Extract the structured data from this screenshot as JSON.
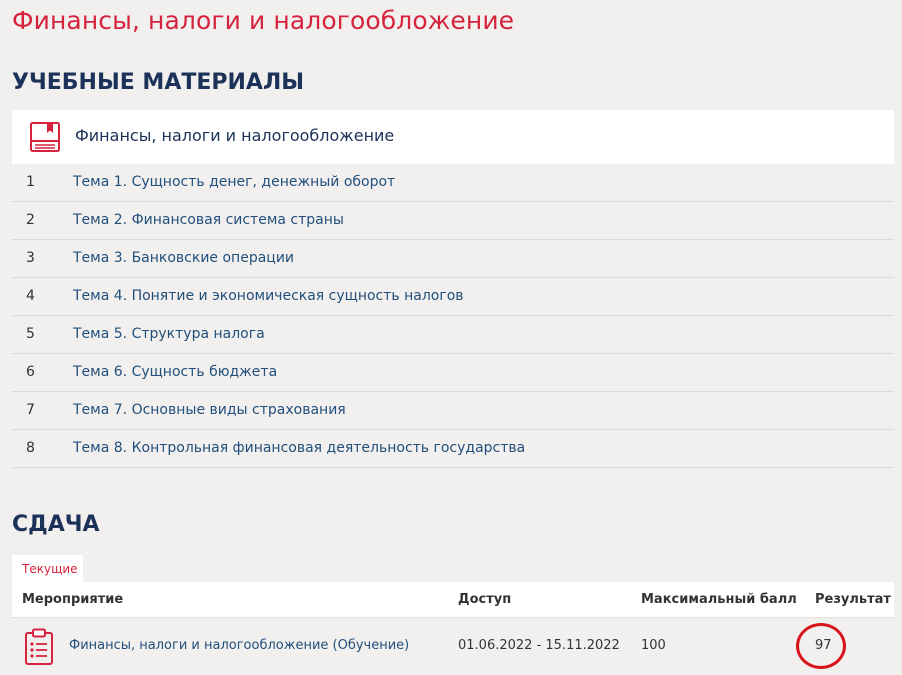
{
  "page_title": "Финансы, налоги и налогообложение",
  "materials": {
    "heading": "УЧЕБНЫЕ МАТЕРИАЛЫ",
    "course_title": "Финансы, налоги и налогообложение",
    "course_icon": "book-icon",
    "topics": [
      {
        "num": "1",
        "title": "Тема 1. Сущность денег, денежный оборот"
      },
      {
        "num": "2",
        "title": "Тема 2. Финансовая система страны"
      },
      {
        "num": "3",
        "title": "Тема 3. Банковские операции"
      },
      {
        "num": "4",
        "title": "Тема 4. Понятие и экономическая сущность налогов"
      },
      {
        "num": "5",
        "title": "Тема 5. Структура налога"
      },
      {
        "num": "6",
        "title": "Тема 6. Сущность бюджета"
      },
      {
        "num": "7",
        "title": "Тема 7. Основные виды страхования"
      },
      {
        "num": "8",
        "title": "Тема 8. Контрольная финансовая деятельность государства"
      }
    ]
  },
  "submission": {
    "heading": "СДАЧА",
    "tab_current": "Текущие",
    "columns": {
      "event": "Мероприятие",
      "access": "Доступ",
      "max_score": "Максимальный балл",
      "result": "Результат"
    },
    "rows": [
      {
        "icon": "clipboard-list-icon",
        "event": "Финансы, налоги и налогообложение (Обучение)",
        "access": "01.06.2022 - 15.11.2022",
        "max_score": "100",
        "result": "97"
      }
    ]
  },
  "colors": {
    "accent_red": "#d5233e",
    "heading_navy": "#1c3259",
    "link_blue": "#234f7d",
    "background": "#f1f0ee",
    "highlight_circle": "#d8141d"
  }
}
